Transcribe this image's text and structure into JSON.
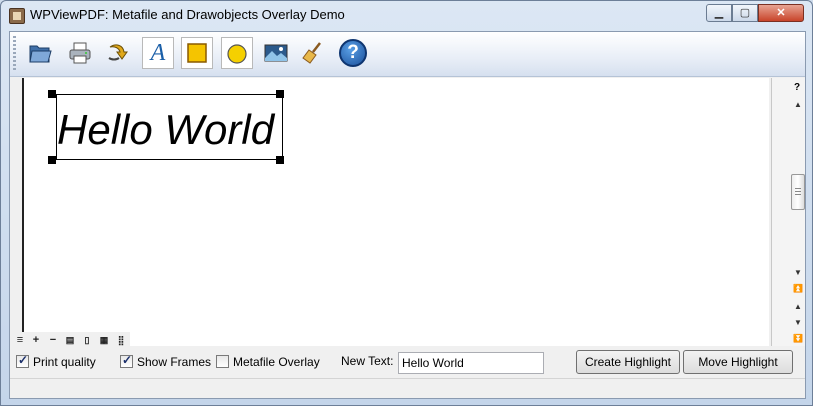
{
  "window": {
    "title": "WPViewPDF: Metafile and Drawobjects Overlay Demo",
    "minimize_icon": "minimize-icon",
    "maximize_icon": "maximize-icon",
    "close_icon": "close-icon"
  },
  "toolbar": {
    "buttons": [
      {
        "icon": "open-folder-icon"
      },
      {
        "icon": "printer-icon"
      },
      {
        "icon": "arrow-icon"
      },
      {
        "icon": "text-icon",
        "glyph": "A"
      },
      {
        "icon": "square-icon"
      },
      {
        "icon": "circle-icon"
      },
      {
        "icon": "image-icon"
      },
      {
        "icon": "broom-icon"
      },
      {
        "icon": "help-icon",
        "glyph": "?"
      }
    ]
  },
  "document": {
    "text_object": "Hello World"
  },
  "scrollbar": {
    "help_glyph": "?"
  },
  "zoom_bar": {
    "icons": [
      "menu-icon",
      "zoom-in-icon",
      "zoom-out-icon",
      "fit-width-icon",
      "single-page-icon",
      "two-pages-icon",
      "multi-page-icon"
    ],
    "plus": "+",
    "minus": "−"
  },
  "options": {
    "print_quality": {
      "label": "Print quality",
      "checked": true
    },
    "show_frames": {
      "label": "Show Frames",
      "checked": true
    },
    "metafile_overlay": {
      "label": "Metafile Overlay",
      "checked": false
    }
  },
  "new_text": {
    "label": "New Text:",
    "value": "Hello World"
  },
  "actions": {
    "create_highlight": "Create Highlight",
    "move_highlight": "Move Highlight"
  },
  "colors": {
    "titlebar": "#dce7f4",
    "close_button": "#c8442a",
    "accent_blue": "#1b5fa8",
    "square_fill": "#f5c400",
    "circle_fill": "#f5d000"
  }
}
